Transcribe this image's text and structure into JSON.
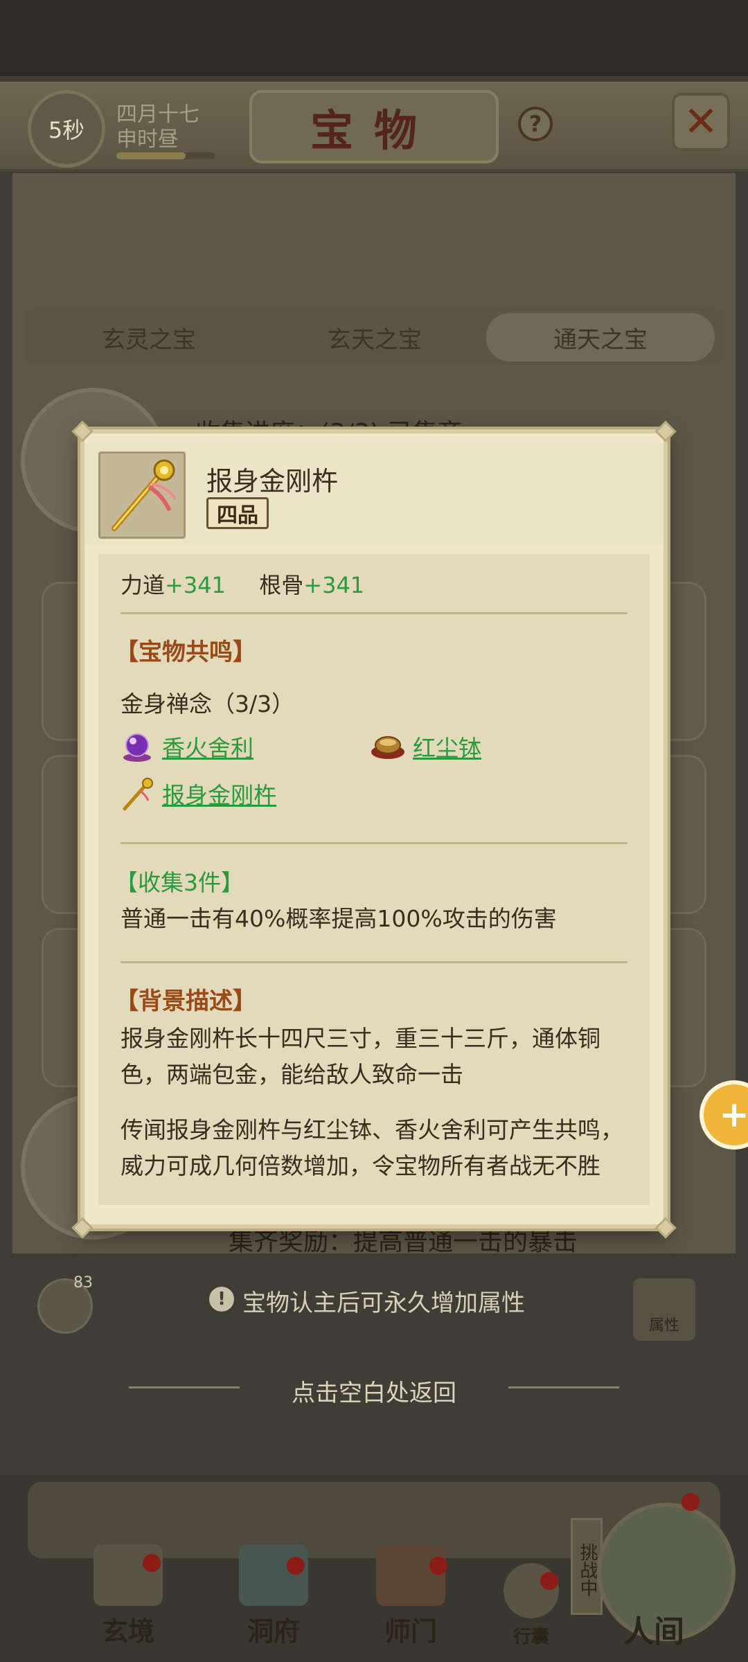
{
  "header": {
    "timer": "5秒",
    "date": "四月十七",
    "time_of_day": "申时昼",
    "title": "宝物",
    "help_label": "?",
    "close_label": "✕",
    "time_progress": 0.7
  },
  "tabs": [
    {
      "label": "玄灵之宝",
      "active": false
    },
    {
      "label": "玄天之宝",
      "active": false
    },
    {
      "label": "通天之宝",
      "active": true
    }
  ],
  "background": {
    "collect_progress": "收集进度：(3/3) 已集齐",
    "set_reward": "集齐奖励：提高普通一击的暴击"
  },
  "modal": {
    "item_name": "报身金刚杵",
    "grade": "四品",
    "stats": [
      {
        "label": "力道",
        "value": "+341"
      },
      {
        "label": "根骨",
        "value": "+341"
      }
    ],
    "resonance_title": "【宝物共鸣】",
    "set_name": "金身禅念（3/3）",
    "set_items": [
      {
        "name": "香火舍利",
        "icon": "purple-orb-icon"
      },
      {
        "name": "红尘钵",
        "icon": "alms-bowl-icon"
      },
      {
        "name": "报身金刚杵",
        "icon": "vajra-scepter-icon"
      }
    ],
    "collect_title": "【收集3件】",
    "collect_desc": "普通一击有40%概率提高100%攻击的伤害",
    "background_title": "【背景描述】",
    "background_desc_1": "报身金刚杵长十四尺三寸，重三十三斤，通体铜色，两端包金，能给敌人致命一击",
    "background_desc_2": "传闻报身金刚杵与红尘钵、香火舍利可产生共鸣，威力可成几何倍数增加，令宝物所有者战无不胜"
  },
  "bottom": {
    "chat_count": "83",
    "notice": "宝物认主后可永久增加属性",
    "attr_label": "属性",
    "return_hint": "点击空白处返回"
  },
  "nav": {
    "items": [
      "玄境",
      "洞府",
      "师门",
      "行囊",
      "人间"
    ],
    "challenge_tag": "挑战中"
  },
  "colors": {
    "green_text": "#2c9a3c",
    "section_title": "#9a4a16",
    "modal_bg": "#efe6cb",
    "badge_red": "#8c1d16"
  }
}
